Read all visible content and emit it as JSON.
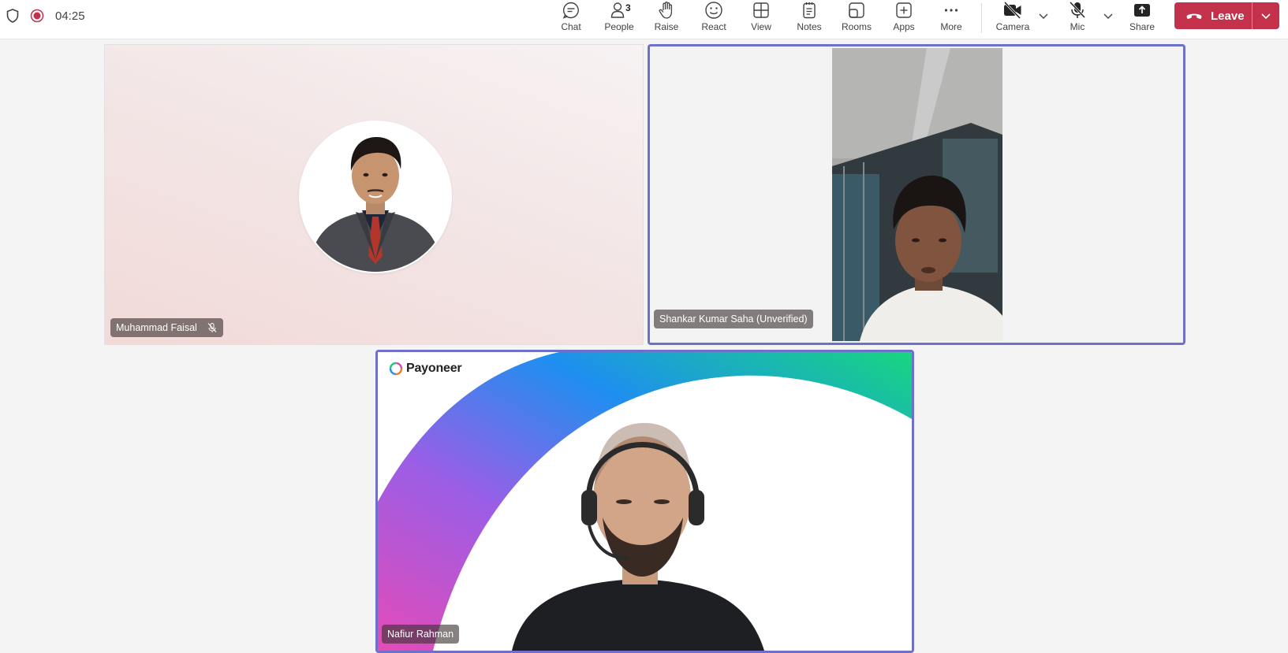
{
  "status": {
    "timer": "04:25"
  },
  "toolbar": {
    "chat": "Chat",
    "people": "People",
    "people_count": "3",
    "raise": "Raise",
    "react": "React",
    "view": "View",
    "notes": "Notes",
    "rooms": "Rooms",
    "apps": "Apps",
    "more": "More",
    "camera": "Camera",
    "mic": "Mic",
    "share": "Share",
    "leave": "Leave"
  },
  "participants": [
    {
      "name": "Muhammad Faisal",
      "muted": true
    },
    {
      "name": "Shankar Kumar Saha (Unverified)"
    },
    {
      "name": "Nafiur Rahman",
      "logo": "Payoneer"
    }
  ],
  "colors": {
    "leave": "#c4314b",
    "active_speaker_border": "#6f70c9",
    "recording": "#c4314b"
  }
}
